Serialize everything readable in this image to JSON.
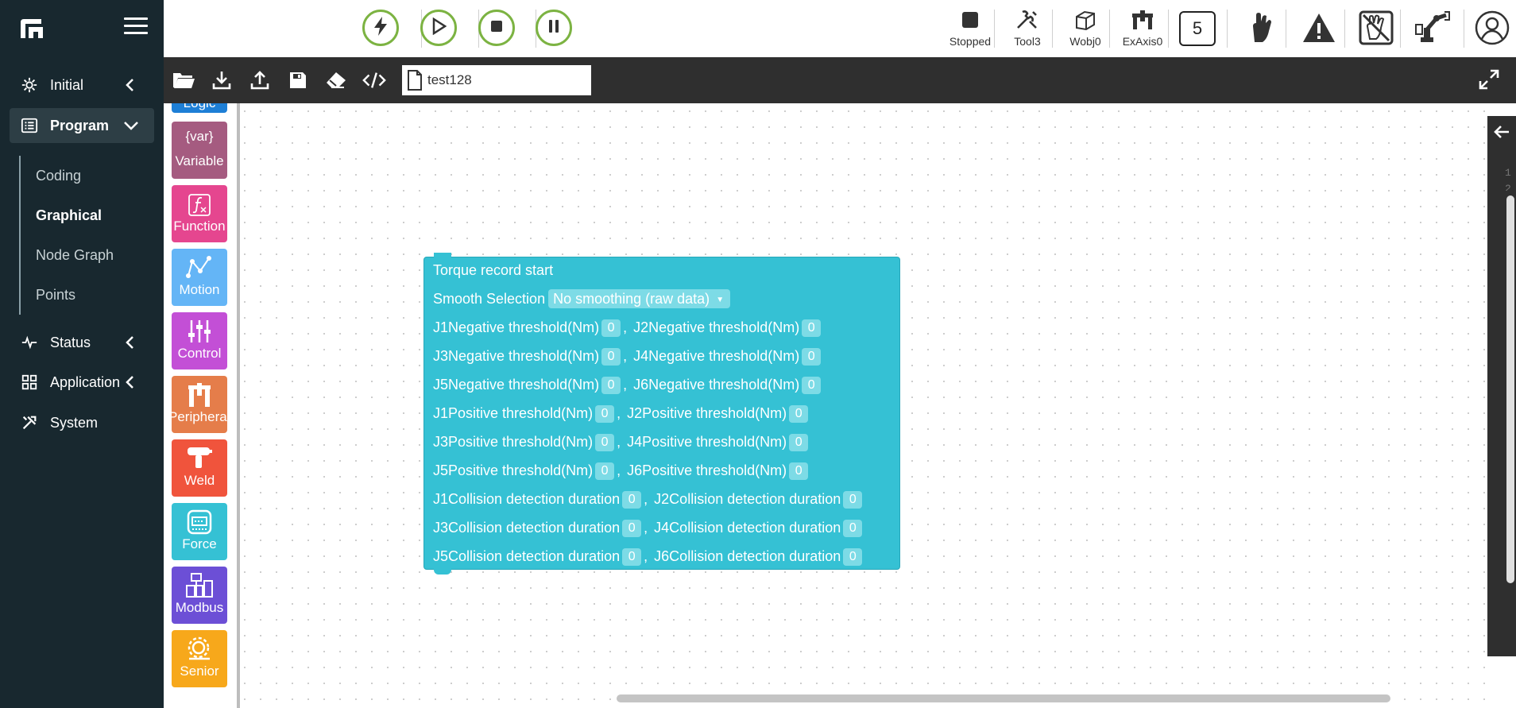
{
  "sidebar": {
    "items": [
      {
        "label": "Initial",
        "icon": "gear-icon"
      },
      {
        "label": "Program",
        "icon": "list-icon"
      },
      {
        "label": "Status",
        "icon": "pulse-icon"
      },
      {
        "label": "Application",
        "icon": "grid-icon"
      },
      {
        "label": "System",
        "icon": "tools-icon"
      }
    ],
    "sub_items": [
      "Coding",
      "Graphical",
      "Node Graph",
      "Points"
    ],
    "selected_sub": "Graphical"
  },
  "topbar": {
    "controls": [
      "lightning-icon",
      "play-icon",
      "stop-icon",
      "pause-icon"
    ],
    "status": [
      {
        "label": "Stopped",
        "icon": "stop-square-icon"
      },
      {
        "label": "Tool3",
        "icon": "wrench-icon"
      },
      {
        "label": "Wobj0",
        "icon": "cube-icon"
      },
      {
        "label": "ExAxis0",
        "icon": "gantry-icon"
      }
    ],
    "speed_box": "5",
    "accent_color": "#7cb342"
  },
  "toolbar": {
    "icons": [
      "folder-open-icon",
      "download-icon",
      "upload-icon",
      "save-icon",
      "eraser-icon",
      "code-icon"
    ],
    "filename": "test128"
  },
  "toolbox": {
    "categories": [
      {
        "label": "Logic",
        "color": "#1e7fd6"
      },
      {
        "label": "Variable",
        "color": "#a55b80"
      },
      {
        "label": "Function",
        "color": "#e5468f"
      },
      {
        "label": "Motion",
        "color": "#64b5f6"
      },
      {
        "label": "Control",
        "color": "#c34fd6"
      },
      {
        "label": "Peripheral",
        "color": "#e57d4a"
      },
      {
        "label": "Weld",
        "color": "#f0543c"
      },
      {
        "label": "Force",
        "color": "#35c1d4"
      },
      {
        "label": "Modbus",
        "color": "#6c4fd6"
      },
      {
        "label": "Senior",
        "color": "#f7a81b"
      }
    ],
    "variable_glyph": "{var}"
  },
  "block": {
    "title": "Torque record start",
    "smooth_label": "Smooth Selection",
    "smooth_value": "No smoothing (raw data)",
    "sep": ",",
    "rows": [
      {
        "a": "J1Negative threshold(Nm)",
        "av": "0",
        "b": "J2Negative threshold(Nm)",
        "bv": "0"
      },
      {
        "a": "J3Negative threshold(Nm)",
        "av": "0",
        "b": "J4Negative threshold(Nm)",
        "bv": "0"
      },
      {
        "a": "J5Negative threshold(Nm)",
        "av": "0",
        "b": "J6Negative threshold(Nm)",
        "bv": "0"
      },
      {
        "a": "J1Positive threshold(Nm)",
        "av": "0",
        "b": "J2Positive threshold(Nm)",
        "bv": "0"
      },
      {
        "a": "J3Positive threshold(Nm)",
        "av": "0",
        "b": "J4Positive threshold(Nm)",
        "bv": "0"
      },
      {
        "a": "J5Positive threshold(Nm)",
        "av": "0",
        "b": "J6Positive threshold(Nm)",
        "bv": "0"
      },
      {
        "a": "J1Collision detection duration",
        "av": "0",
        "b": "J2Collision detection duration",
        "bv": "0"
      },
      {
        "a": "J3Collision detection duration",
        "av": "0",
        "b": "J4Collision detection duration",
        "bv": "0"
      },
      {
        "a": "J5Collision detection duration",
        "av": "0",
        "b": "J6Collision detection duration",
        "bv": "0"
      }
    ],
    "color": "#35c1d4"
  },
  "right_panel": {
    "line_numbers": [
      "1",
      "2"
    ]
  }
}
